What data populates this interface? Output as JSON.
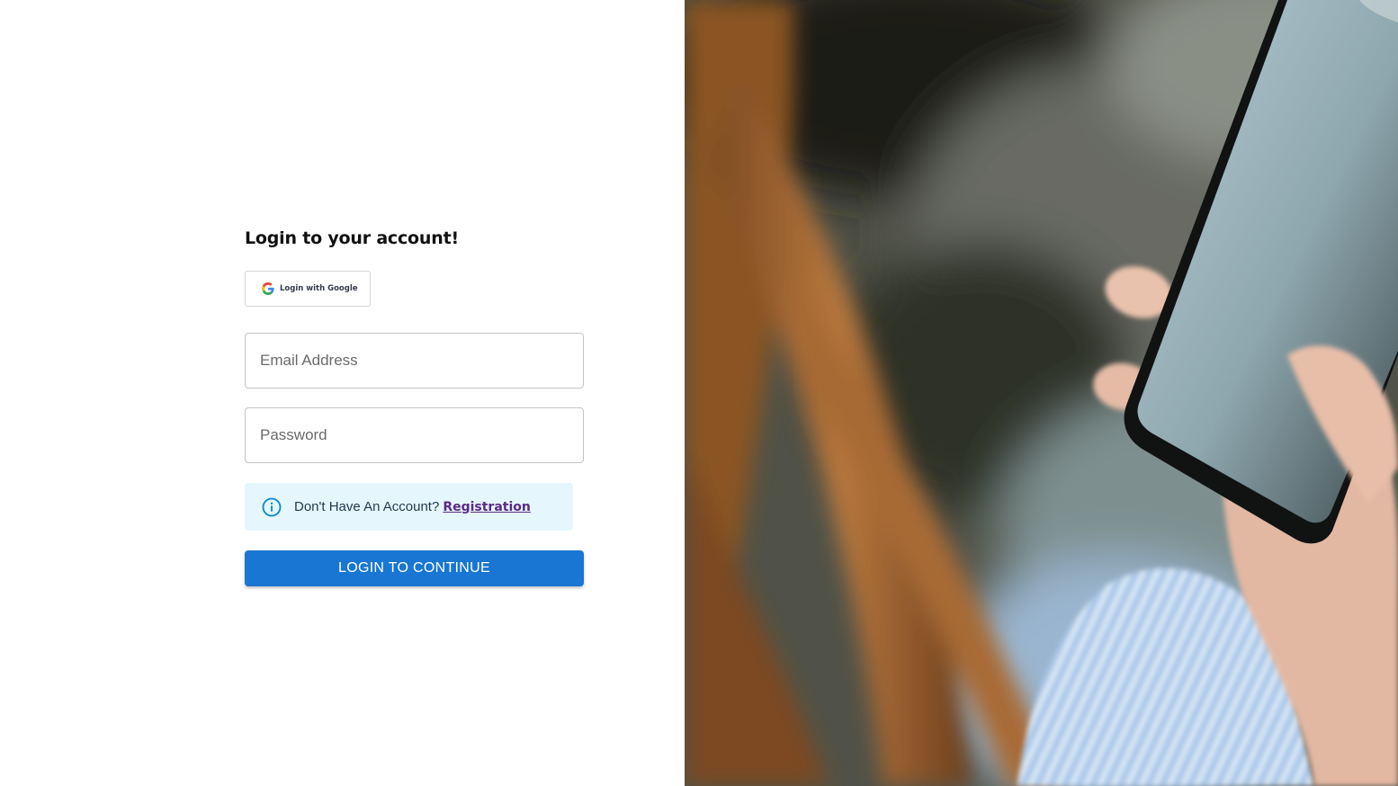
{
  "login": {
    "title": "Login to your account!",
    "google_button_label": "Login with Google",
    "email_placeholder": "Email Address",
    "password_placeholder": "Password",
    "info_text": "Don't Have An Account?",
    "registration_link": "Registration",
    "submit_label": "LOGIN TO CONTINUE"
  },
  "icons": {
    "google": "google-logo-icon",
    "info": "info-circle-icon"
  },
  "colors": {
    "primary": "#1976d2",
    "info_background": "#e5f6fd",
    "info_icon": "#0288d1",
    "link": "#5b2a86"
  },
  "hero_image": {
    "subject": "hands holding a smartphone"
  }
}
